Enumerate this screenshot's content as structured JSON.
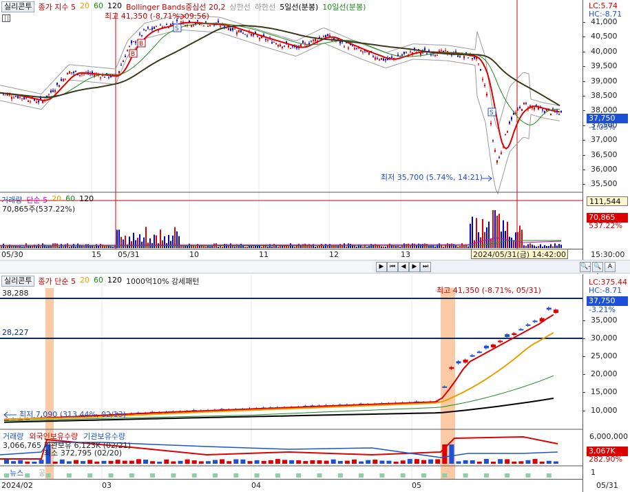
{
  "top_chart": {
    "symbol": "실리콘투",
    "legends": [
      {
        "text": "종가 지수 5",
        "color": "#cc0000"
      },
      {
        "text": "20",
        "color": "#e8a000"
      },
      {
        "text": "60",
        "color": "#1a8a1a"
      },
      {
        "text": "120",
        "color": "#000000"
      },
      {
        "text": "Bollinger Bands중심선 20,2",
        "color": "#cc0000"
      },
      {
        "text": "상한선",
        "color": "#999999"
      },
      {
        "text": "하한선",
        "color": "#999999"
      },
      {
        "text": "5일선(분봉)",
        "color": "#000000"
      },
      {
        "text": "10일선(분봉)",
        "color": "#1a8a1a"
      }
    ],
    "high_annotation": "최고 41,350 (-8.71%, 09:56)",
    "low_annotation": "최저 35,700 (5.74%, 14:21)",
    "lc": "LC:5.74",
    "hc": "HC:-8.71",
    "y_ticks": [
      "41,000",
      "40,500",
      "40,000",
      "39,500",
      "39,000",
      "38,500",
      "38,000",
      "37,500",
      "37,000",
      "36,500",
      "36,000",
      "35,500"
    ],
    "current_price": "37,750",
    "current_change": "-1.05%",
    "colors": {
      "up": "#dd0000",
      "down": "#0000cc",
      "current_tag": "#1d4fd8"
    }
  },
  "volume_panel": {
    "title": "거래량",
    "legend": [
      {
        "text": "단순 5",
        "color": "#cc00cc"
      },
      {
        "text": "20",
        "color": "#e8a000"
      },
      {
        "text": "60",
        "color": "#1a8a1a"
      },
      {
        "text": "120",
        "color": "#000000"
      }
    ],
    "value_label": "70,865주(537.22%)",
    "tag_line": "111,544",
    "tag_value": "70,865",
    "tag_pct": "537.22%"
  },
  "top_dates": [
    "05/30",
    "15",
    "05/31",
    "10",
    "11",
    "12",
    "13"
  ],
  "crosshair_time": "2024/05/31(금) 14:42:00",
  "top_axis_time": "15:30:00",
  "scroll_buttons": [
    "▶",
    "⏮",
    "◀",
    "▶",
    "⏭",
    "🔍-",
    "🔍+",
    "A"
  ],
  "bottom_chart": {
    "symbol": "실리콘투",
    "legends": [
      {
        "text": "종가 단순 5",
        "color": "#cc0000"
      },
      {
        "text": "20",
        "color": "#e8a000"
      },
      {
        "text": "60",
        "color": "#1a8a1a"
      },
      {
        "text": "120",
        "color": "#000000"
      },
      {
        "text": "1000억10% 강세패턴",
        "color": "#222222"
      }
    ],
    "left_value": "38,288",
    "support_value": "28,227",
    "high_annotation": "최고 41,350 (-8.71%, 05/31)",
    "low_annotation": "최저 7,090 (313.44%, 02/13)",
    "lc": "LC:375.44",
    "hc": "HC:-8.71",
    "y_ticks": [
      "35,000",
      "30,000",
      "25,000",
      "20,000",
      "15,000",
      "10,000"
    ],
    "current_price": "37,750",
    "current_change": "-3.21%"
  },
  "bottom_volume": {
    "legend": [
      {
        "text": "거래량",
        "color": "#1a55cc"
      },
      {
        "text": "외국인보유수량",
        "color": "#cc0000"
      },
      {
        "text": "기관보유수량",
        "color": "#1a55cc"
      }
    ],
    "ann1": "3,066,765 기관보유 6,123K (02/21)",
    "ann2": "최소 372,795 (02/20)",
    "y_tick": "6,000,000",
    "tag_value": "3,067K",
    "tag_pct": "282.90%"
  },
  "news_panel": {
    "title": "뉴스",
    "extra": "공",
    "tick": "1"
  },
  "bottom_dates": [
    "2024/02",
    "03",
    "04",
    "05",
    "05/31"
  ]
}
